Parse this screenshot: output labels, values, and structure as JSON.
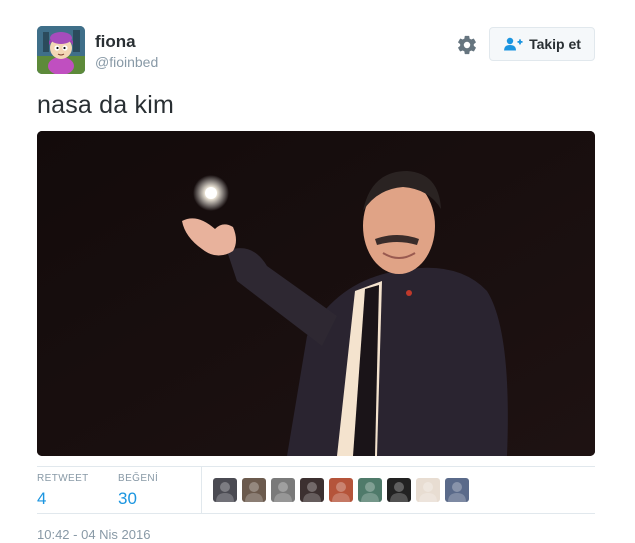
{
  "author": {
    "display_name": "fiona",
    "handle": "@fioinbed",
    "avatar_icon": "cartoon-avatar"
  },
  "actions": {
    "settings_icon": "gear-icon",
    "follow_icon": "add-user-icon",
    "follow_label": "Takip et"
  },
  "tweet": {
    "text": "nasa da kim",
    "timestamp": "10:42 - 04 Nis 2016"
  },
  "stats": {
    "retweet_label": "RETWEET",
    "retweet_count": "4",
    "like_label": "BEĞENİ",
    "like_count": "30"
  },
  "likers": [
    {
      "icon": "user-avatar",
      "color": "#4a4a52"
    },
    {
      "icon": "user-avatar",
      "color": "#6b5a4d"
    },
    {
      "icon": "user-avatar",
      "color": "#7a7a7a"
    },
    {
      "icon": "user-avatar",
      "color": "#3c3030"
    },
    {
      "icon": "user-avatar",
      "color": "#b5543a"
    },
    {
      "icon": "user-avatar",
      "color": "#4f7a6a"
    },
    {
      "icon": "user-avatar",
      "color": "#222222"
    },
    {
      "icon": "user-avatar",
      "color": "#e8ddd2"
    },
    {
      "icon": "user-avatar",
      "color": "#5a6a8a"
    }
  ],
  "colors": {
    "link_blue": "#1b95e0",
    "muted_gray": "#8899a6",
    "text_dark": "#292f33"
  }
}
